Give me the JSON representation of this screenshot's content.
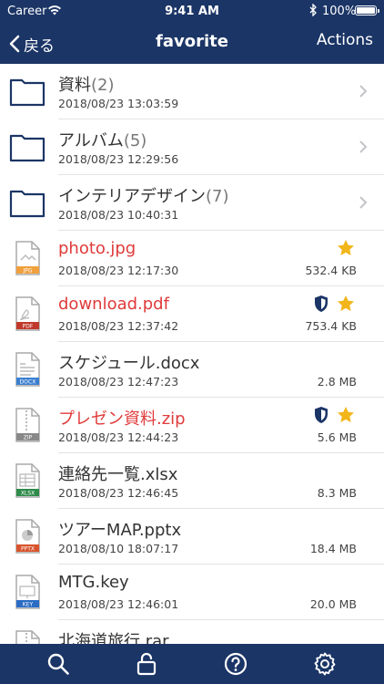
{
  "status": {
    "carrier": "Career",
    "time": "9:41 AM",
    "battery": "100%"
  },
  "nav": {
    "back_label": "戻る",
    "title": "favorite",
    "actions_label": "Actions"
  },
  "colors": {
    "bar": "#1b3566",
    "favorite_name": "#e03a3a",
    "star": "#f2b51a"
  },
  "folders": [
    {
      "name": "資料",
      "count": "(2)",
      "date": "2018/08/23 13:03:59"
    },
    {
      "name": "アルバム",
      "count": "(5)",
      "date": "2018/08/23 12:29:56"
    },
    {
      "name": "インテリアデザイン",
      "count": "(7)",
      "date": "2018/08/23 10:40:31"
    }
  ],
  "files": [
    {
      "name": "photo.jpg",
      "date": "2018/08/23 12:17:30",
      "size": "532.4 KB",
      "type": "JPG",
      "favorite": true,
      "protected": false
    },
    {
      "name": "download.pdf",
      "date": "2018/08/23 12:37:42",
      "size": "753.4 KB",
      "type": "PDF",
      "favorite": true,
      "protected": true
    },
    {
      "name": "スケジュール.docx",
      "date": "2018/08/23 12:47:23",
      "size": "2.8 MB",
      "type": "DOCX",
      "favorite": false,
      "protected": false
    },
    {
      "name": "プレゼン資料.zip",
      "date": "2018/08/23 12:44:23",
      "size": "5.6 MB",
      "type": "ZIP",
      "favorite": true,
      "protected": true
    },
    {
      "name": "連絡先一覧.xlsx",
      "date": "2018/08/23 12:46:45",
      "size": "8.3 MB",
      "type": "XLSX",
      "favorite": false,
      "protected": false
    },
    {
      "name": "ツアーMAP.pptx",
      "date": "2018/08/10 18:07:17",
      "size": "18.4 MB",
      "type": "PPTX",
      "favorite": false,
      "protected": false
    },
    {
      "name": "MTG.key",
      "date": "2018/08/23 12:46:01",
      "size": "20.0 MB",
      "type": "KEY",
      "favorite": false,
      "protected": false
    },
    {
      "name": "北海道旅行.rar",
      "date": "",
      "size": "",
      "type": "RAR",
      "favorite": false,
      "protected": false
    }
  ],
  "tabbar": [
    "search-icon",
    "lock-icon",
    "help-icon",
    "settings-icon"
  ]
}
